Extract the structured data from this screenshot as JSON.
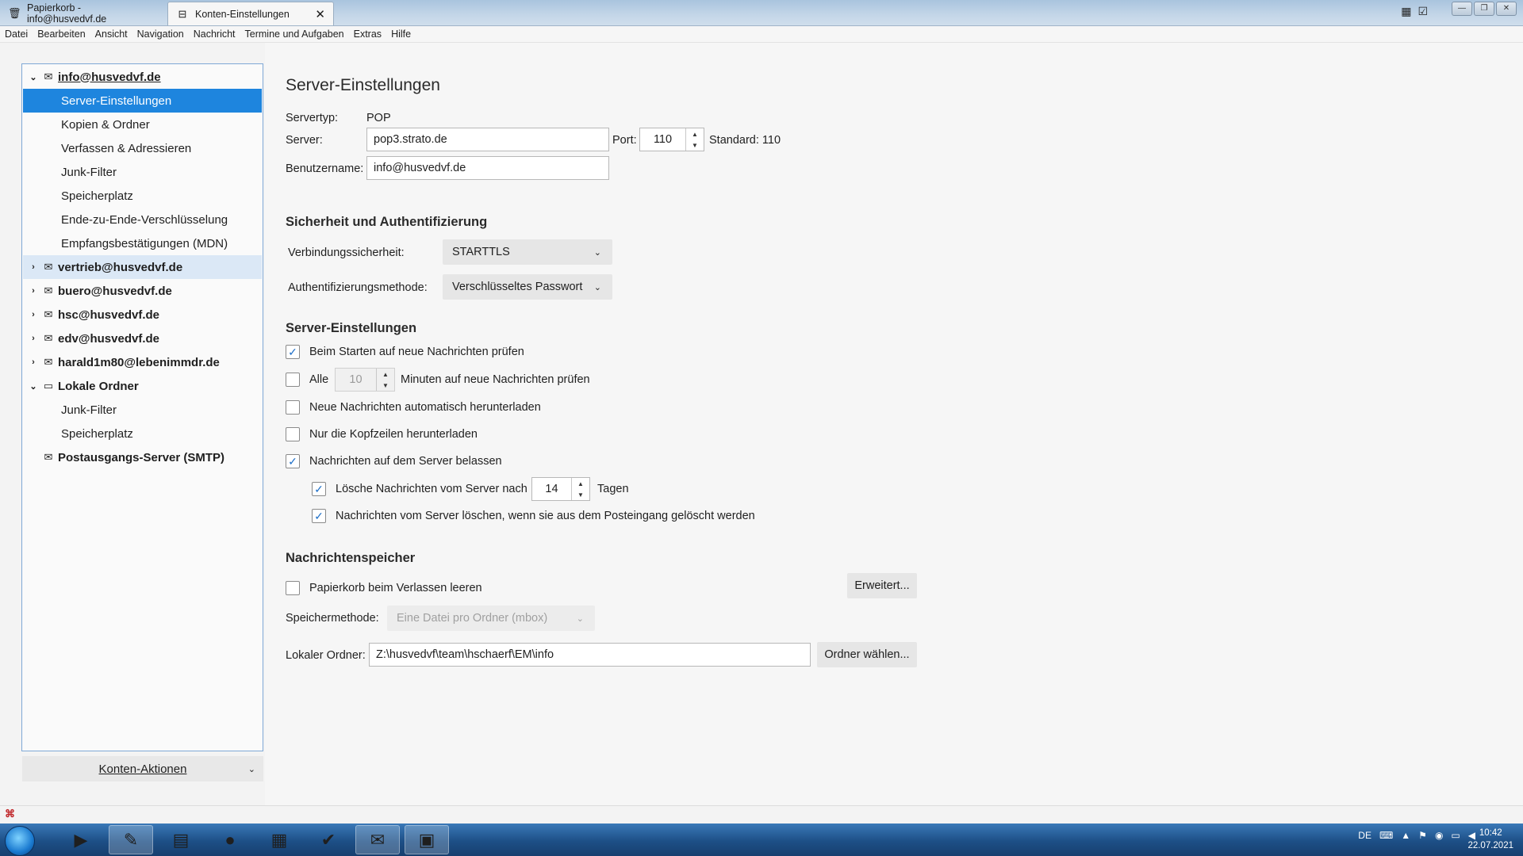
{
  "titlebar": {
    "tabs": [
      {
        "label": "Papierkorb - info@husvedvf.de",
        "icon": "trash-icon"
      },
      {
        "label": "Konten-Einstellungen",
        "icon": "settings-page-icon"
      }
    ]
  },
  "menu": [
    "Datei",
    "Bearbeiten",
    "Ansicht",
    "Navigation",
    "Nachricht",
    "Termine und Aufgaben",
    "Extras",
    "Hilfe"
  ],
  "sidebar": {
    "account_main": "info@husvedvf.de",
    "children": [
      "Server-Einstellungen",
      "Kopien & Ordner",
      "Verfassen & Adressieren",
      "Junk-Filter",
      "Speicherplatz",
      "Ende-zu-Ende-Verschlüsselung",
      "Empfangsbestätigungen (MDN)"
    ],
    "accounts": [
      "vertrieb@husvedvf.de",
      "buero@husvedvf.de",
      "hsc@husvedvf.de",
      "edv@husvedvf.de",
      "harald1m80@lebenimmdr.de"
    ],
    "local": "Lokale Ordner",
    "local_children": [
      "Junk-Filter",
      "Speicherplatz"
    ],
    "smtp": "Postausgangs-Server (SMTP)",
    "actions": "Konten-Aktionen"
  },
  "main": {
    "title": "Server-Einstellungen",
    "servertyp_label": "Servertyp:",
    "servertyp_value": "POP",
    "server_label": "Server:",
    "server_value": "pop3.strato.de",
    "port_label": "Port:",
    "port_value": "110",
    "standard": "Standard: 110",
    "user_label": "Benutzername:",
    "user_value": "info@husvedvf.de",
    "security_heading": "Sicherheit und Authentifizierung",
    "conn_label": "Verbindungssicherheit:",
    "conn_value": "STARTTLS",
    "auth_label": "Authentifizierungsmethode:",
    "auth_value": "Verschlüsseltes Passwort",
    "server_settings_heading": "Server-Einstellungen",
    "cb_start": "Beim Starten auf neue Nachrichten prüfen",
    "cb_all": "Alle",
    "minutes_value": "10",
    "minutes_label": "Minuten auf neue Nachrichten prüfen",
    "cb_auto": "Neue Nachrichten automatisch herunterladen",
    "cb_headers": "Nur die Kopfzeilen herunterladen",
    "cb_leave": "Nachrichten auf dem Server belassen",
    "cb_delete_after": "Lösche Nachrichten vom Server nach",
    "days_value": "14",
    "days_label": "Tagen",
    "cb_delete_inbox": "Nachrichten vom Server löschen, wenn sie aus dem Posteingang gelöscht werden",
    "storage_heading": "Nachrichtenspeicher",
    "cb_trash": "Papierkorb beim Verlassen leeren",
    "advanced_btn": "Erweitert...",
    "store_label": "Speichermethode:",
    "store_value": "Eine Datei pro Ordner (mbox)",
    "local_label": "Lokaler Ordner:",
    "local_value": "Z:\\husvedvf\\team\\hschaerf\\EM\\info",
    "choose_btn": "Ordner wählen..."
  },
  "tray": {
    "lang": "DE",
    "time": "10:42",
    "date": "22.07.2021"
  }
}
